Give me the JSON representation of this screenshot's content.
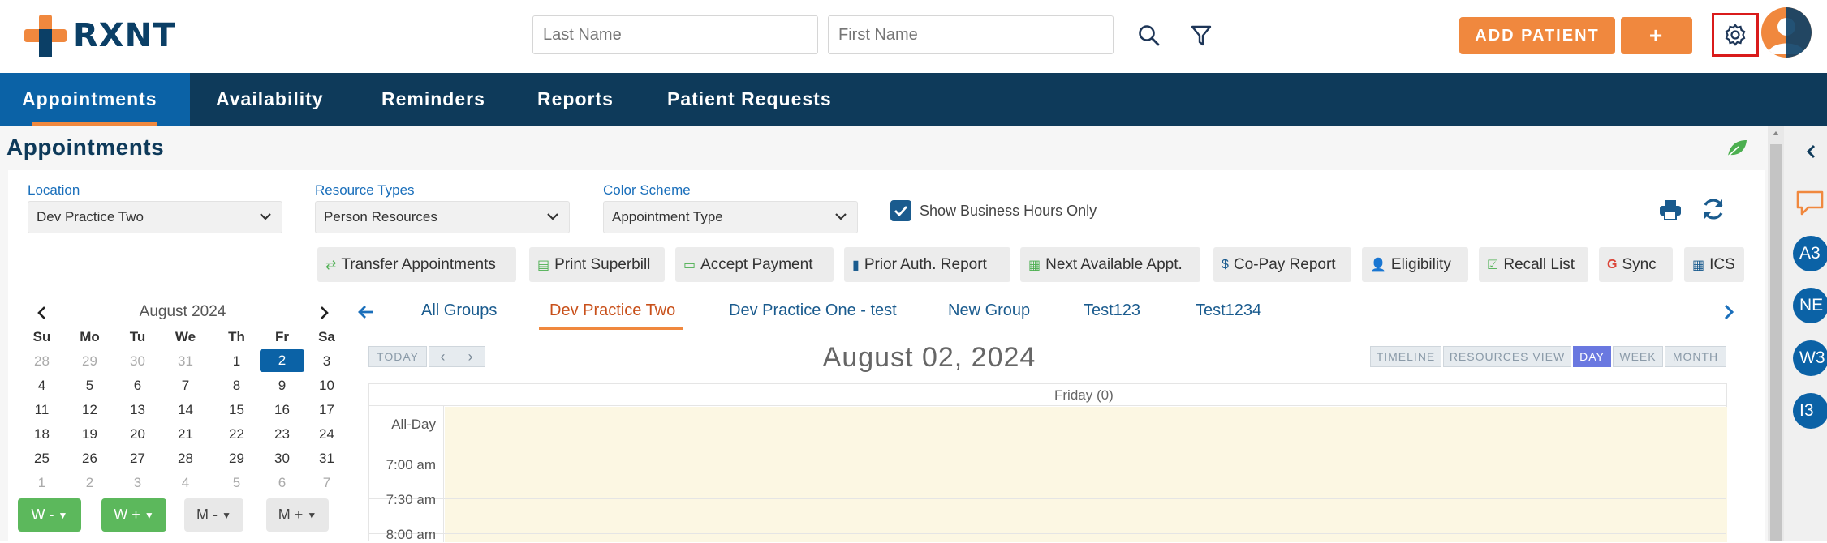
{
  "header": {
    "brand": "RXNT",
    "last_name_placeholder": "Last Name",
    "first_name_placeholder": "First Name",
    "add_patient_label": "ADD PATIENT",
    "add_label": "+",
    "accent": "#f0883e",
    "brand_color": "#0b3f66",
    "icons": [
      "search-icon",
      "filter-icon",
      "gear-icon",
      "avatar"
    ]
  },
  "nav": {
    "items": [
      {
        "label": "Appointments",
        "active": true
      },
      {
        "label": "Availability"
      },
      {
        "label": "Reminders"
      },
      {
        "label": "Reports"
      },
      {
        "label": "Patient Requests"
      }
    ]
  },
  "page": {
    "title": "Appointments",
    "location_label": "Location",
    "location_value": "Dev Practice Two",
    "resource_types_label": "Resource Types",
    "resource_types_value": "Person Resources",
    "color_scheme_label": "Color Scheme",
    "color_scheme_value": "Appointment Type",
    "show_business_hours_label": "Show Business Hours Only",
    "show_business_hours_checked": true
  },
  "toolbar": {
    "buttons": [
      {
        "label": "Transfer Appointments",
        "icon": "transfer-icon"
      },
      {
        "label": "Print Superbill",
        "icon": "document-icon"
      },
      {
        "label": "Accept Payment",
        "icon": "money-icon"
      },
      {
        "label": "Prior Auth. Report",
        "icon": "book-icon"
      },
      {
        "label": "Next Available Appt.",
        "icon": "calendar-icon"
      },
      {
        "label": "Co-Pay Report",
        "icon": "dollar-icon"
      },
      {
        "label": "Eligibility",
        "icon": "user-check-icon"
      },
      {
        "label": "Recall List",
        "icon": "check-square-icon"
      },
      {
        "label": "Sync",
        "icon": "google-icon"
      },
      {
        "label": "ICS",
        "icon": "calendar-icon"
      }
    ]
  },
  "mini_calendar": {
    "title": "August 2024",
    "weekdays": [
      "Su",
      "Mo",
      "Tu",
      "We",
      "Th",
      "Fr",
      "Sa"
    ],
    "weeks": [
      [
        "28",
        "29",
        "30",
        "31",
        "1",
        "2",
        "3"
      ],
      [
        "4",
        "5",
        "6",
        "7",
        "8",
        "9",
        "10"
      ],
      [
        "11",
        "12",
        "13",
        "14",
        "15",
        "16",
        "17"
      ],
      [
        "18",
        "19",
        "20",
        "21",
        "22",
        "23",
        "24"
      ],
      [
        "25",
        "26",
        "27",
        "28",
        "29",
        "30",
        "31"
      ],
      [
        "1",
        "2",
        "3",
        "4",
        "5",
        "6",
        "7"
      ]
    ],
    "selected": "2",
    "week_buttons": [
      "W -",
      "W +",
      "M -",
      "M +"
    ]
  },
  "groups": {
    "tabs": [
      "All Groups",
      "Dev Practice Two",
      "Dev Practice One - test",
      "New Group",
      "Test123",
      "Test1234"
    ],
    "active": "Dev Practice Two"
  },
  "scheduler": {
    "today_label": "TODAY",
    "date_title": "August 02, 2024",
    "views": [
      "TIMELINE",
      "RESOURCES VIEW",
      "DAY",
      "WEEK",
      "MONTH"
    ],
    "active_view": "DAY",
    "day_header": "Friday (0)",
    "all_day_label": "All-Day",
    "times": [
      "7:00 am",
      "7:30 am",
      "8:00 am"
    ]
  },
  "right_panel": {
    "bubbles": [
      "A3",
      "NE",
      "W3",
      "I3"
    ]
  }
}
